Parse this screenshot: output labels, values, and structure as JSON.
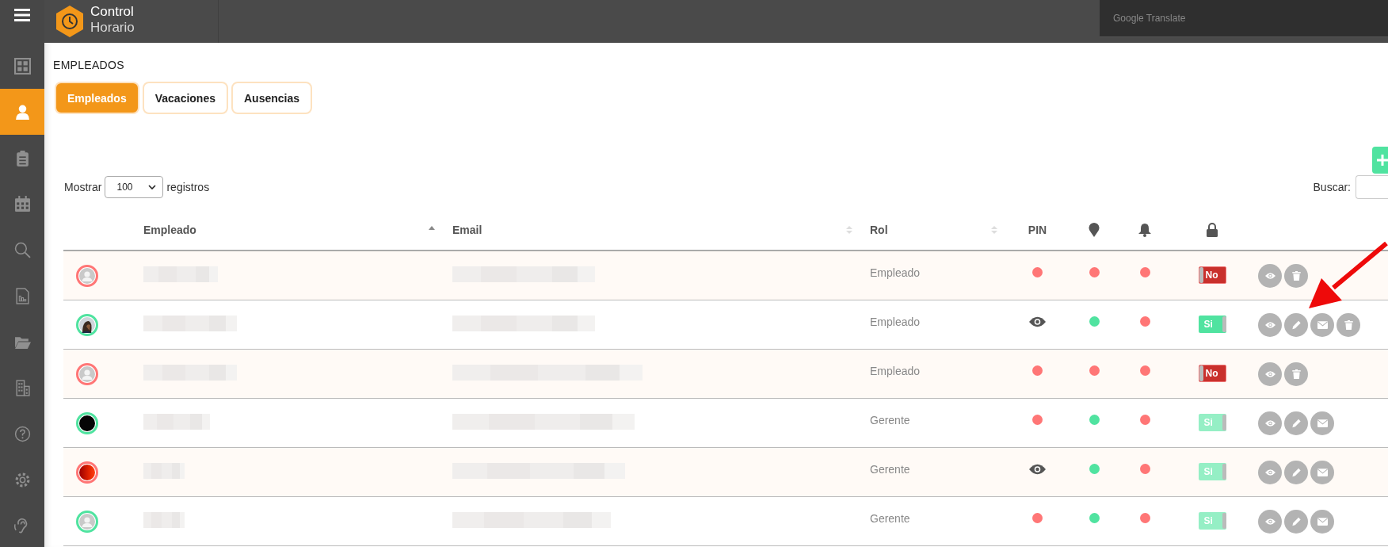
{
  "sidebar": {
    "items": [
      {
        "kind": "dashboard",
        "selected": false
      },
      {
        "kind": "user",
        "selected": true
      },
      {
        "kind": "clipboard",
        "selected": false
      },
      {
        "kind": "calendar",
        "selected": false
      },
      {
        "kind": "search",
        "selected": false
      },
      {
        "kind": "report",
        "selected": false
      },
      {
        "kind": "folder",
        "selected": false
      },
      {
        "kind": "building",
        "selected": false
      },
      {
        "kind": "help",
        "selected": false
      },
      {
        "kind": "settings",
        "selected": false
      },
      {
        "kind": "ear",
        "selected": false
      }
    ]
  },
  "logo": {
    "line1": "Control",
    "line2": "Horario"
  },
  "translate_panel": {
    "label": "Google Translate"
  },
  "page_title": "EMPLEADOS",
  "tabs": [
    {
      "label": "Empleados",
      "selected": true
    },
    {
      "label": "Vacaciones",
      "selected": false
    },
    {
      "label": "Ausencias",
      "selected": false
    }
  ],
  "length": {
    "before": "Mostrar",
    "value": "100",
    "after": "registros"
  },
  "search": {
    "label": "Buscar:"
  },
  "table": {
    "columns": [
      {
        "kind": "sorted",
        "label": "Empleado"
      },
      {
        "kind": "sortable",
        "label": "Email"
      },
      {
        "kind": "sortable",
        "label": "Rol"
      },
      {
        "kind": "plain",
        "label": "PIN"
      },
      {
        "kind": "location"
      },
      {
        "kind": "bell"
      },
      {
        "kind": "lock"
      }
    ],
    "rows": [
      {
        "color": "#ff7676",
        "avatar": {
          "kind": "silhouette"
        },
        "role": "Empleado",
        "pin_set": false,
        "location": false,
        "notifications": false,
        "access": {
          "label": "No",
          "on": false,
          "disabled": false
        },
        "actions": [
          {
            "kind": "view"
          },
          {
            "kind": "delete"
          }
        ]
      },
      {
        "color": "#50e3a0",
        "role": "Empleado",
        "pin_set": true,
        "location": true,
        "notifications": false,
        "access": {
          "label": "Si",
          "on": true,
          "disabled": false
        },
        "actions": [
          {
            "kind": "view"
          },
          {
            "kind": "edit"
          },
          {
            "kind": "mail"
          },
          {
            "kind": "delete"
          }
        ]
      },
      {
        "color": "#ff7676",
        "avatar": {
          "kind": "silhouette"
        },
        "role": "Empleado",
        "pin_set": false,
        "location": false,
        "notifications": false,
        "access": {
          "label": "No",
          "on": false,
          "disabled": false
        },
        "actions": [
          {
            "kind": "view"
          },
          {
            "kind": "delete"
          }
        ]
      },
      {
        "color": "#50e3a0",
        "avatar": {
          "kind": "dark"
        },
        "role": "Gerente",
        "pin_set": false,
        "location": true,
        "notifications": false,
        "access": {
          "label": "Si",
          "on": true,
          "disabled": true
        },
        "actions": [
          {
            "kind": "view"
          },
          {
            "kind": "edit"
          },
          {
            "kind": "mail"
          }
        ]
      },
      {
        "color": "#ff7676",
        "avatar": {
          "kind": "red"
        },
        "role": "Gerente",
        "pin_set": true,
        "location": true,
        "notifications": false,
        "access": {
          "label": "Si",
          "on": true,
          "disabled": true
        },
        "actions": [
          {
            "kind": "view"
          },
          {
            "kind": "edit"
          },
          {
            "kind": "mail"
          }
        ]
      },
      {
        "color": "#50e3a0",
        "avatar": {
          "kind": "silhouette"
        },
        "role": "Gerente",
        "pin_set": false,
        "location": true,
        "notifications": false,
        "access": {
          "label": "Si",
          "on": true,
          "disabled": true
        },
        "actions": [
          {
            "kind": "view"
          },
          {
            "kind": "edit"
          },
          {
            "kind": "mail"
          }
        ]
      }
    ]
  }
}
